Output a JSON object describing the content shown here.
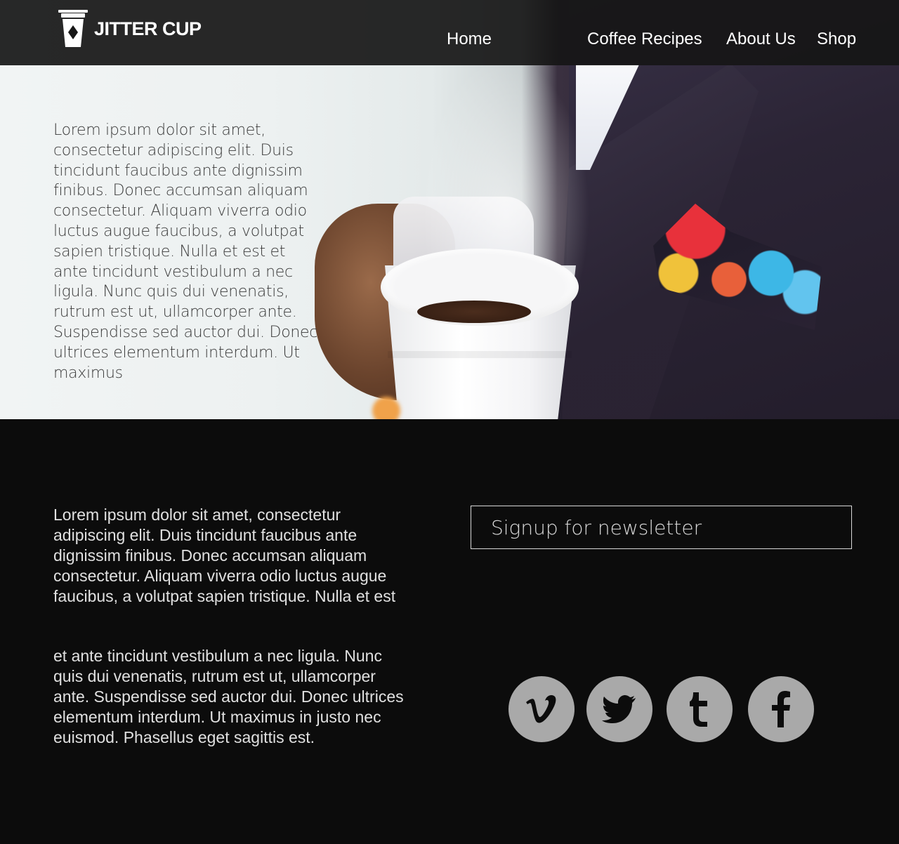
{
  "brand": {
    "name": "JITTER CUP",
    "logo_icon": "coffee-cup-icon"
  },
  "nav": {
    "home": "Home",
    "coffee_recipes": "Coffee Recipes",
    "about_us": "About Us",
    "shop": "Shop"
  },
  "hero": {
    "text": "Lorem ipsum dolor sit amet, consectetur adipiscing elit. Duis tincidunt faucibus ante dignissim finibus. Donec accumsan aliquam consectetur. Aliquam viverra odio luctus augue faucibus, a volutpat sapien tristique. Nulla et est et ante tincidunt vestibulum a nec ligula. Nunc quis dui venenatis, rutrum est ut, ullamcorper ante. Suspendisse sed auctor dui. Donec ultrices elementum interdum. Ut maximus"
  },
  "content": {
    "paragraph_1": "Lorem ipsum dolor sit amet, consectetur adipiscing elit. Duis tincidunt faucibus ante dignissim finibus. Donec accumsan aliquam consectetur. Aliquam viverra odio luctus augue faucibus, a volutpat sapien tristique. Nulla et est",
    "paragraph_2": "et ante tincidunt vestibulum a nec ligula. Nunc quis dui venenatis, rutrum est ut, ullamcorper ante. Suspendisse sed auctor dui. Donec ultrices elementum interdum. Ut maximus in justo nec euismod. Phasellus eget sagittis est."
  },
  "newsletter": {
    "placeholder": "Signup for newsletter"
  },
  "social": [
    {
      "icon": "vimeo-icon"
    },
    {
      "icon": "twitter-icon"
    },
    {
      "icon": "tumblr-icon"
    },
    {
      "icon": "facebook-icon"
    }
  ],
  "colors": {
    "nav_bg": "#161616",
    "page_bg": "#0c0c0c",
    "social_circle": "#a9a9a9",
    "text_light": "#e0e0e0"
  }
}
